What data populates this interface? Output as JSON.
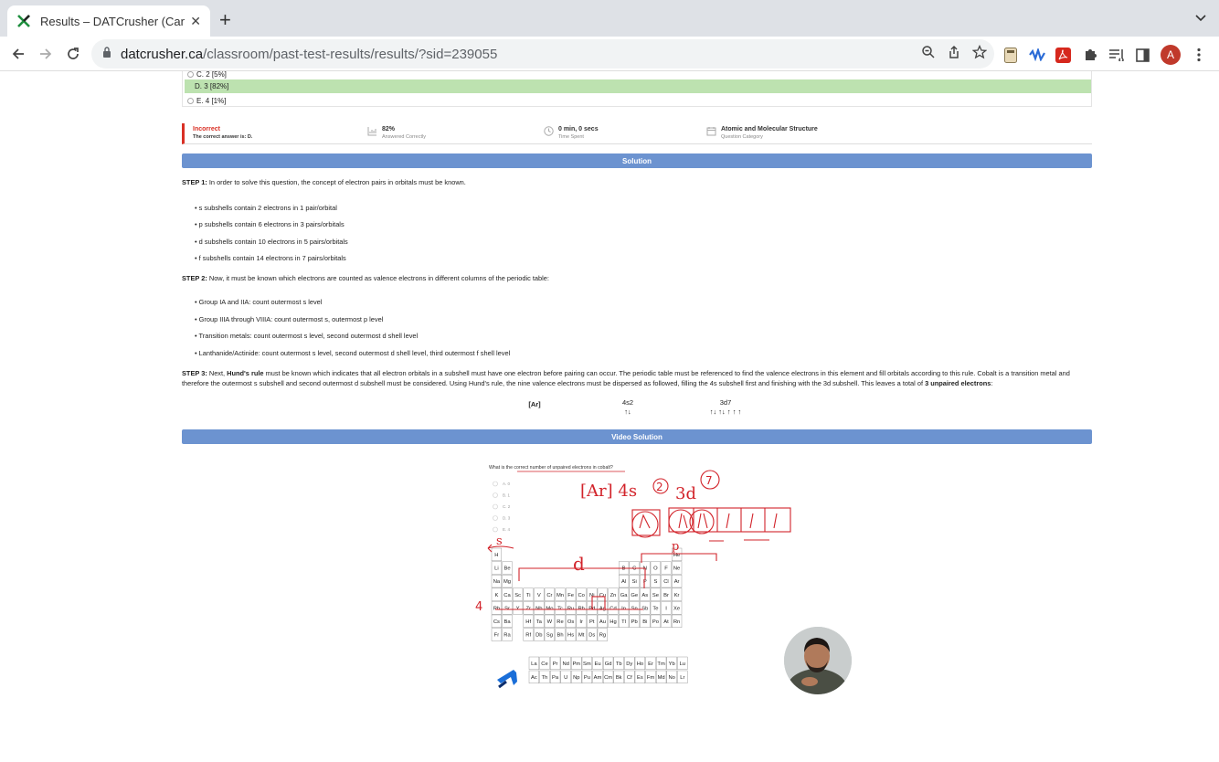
{
  "browser": {
    "tab_title": "Results – DATCrusher (Canadian",
    "url_domain": "datcrusher.ca",
    "url_path": "/classroom/past-test-results/results/?sid=239055",
    "profile_initial": "A"
  },
  "choices": [
    {
      "label": "C. 2 [5%]",
      "selected": false
    },
    {
      "label": "D. 3 [82%]",
      "selected": true
    },
    {
      "label": "E. 4 [1%]",
      "selected": false
    }
  ],
  "stats": {
    "result": "Incorrect",
    "correct_answer": "The correct answer is: D.",
    "percent": "82%",
    "percent_label": "Answered Correctly",
    "time": "0 min, 0 secs",
    "time_label": "Time Spent",
    "category": "Atomic and Molecular Structure",
    "category_label": "Question Category"
  },
  "solution": {
    "header": "Solution",
    "step1_label": "STEP 1:",
    "step1_text": " In order to solve this question, the concept of electron pairs in orbitals must be known.",
    "step1_bullets": [
      "s subshells contain 2 electrons in 1 pair/orbital",
      "p subshells contain 6 electrons in 3 pairs/orbitals",
      "d subshells contain 10 electrons in 5 pairs/orbitals",
      "f subshells contain 14 electrons in 7 pairs/orbitals"
    ],
    "step2_label": "STEP 2:",
    "step2_text": " Now, it must be known which electrons are counted as valence electrons in different columns of the periodic table:",
    "step2_bullets": [
      "Group IA and IIA: count outermost s level",
      "Group IIIA through VIIIA: count outermost s, outermost p level",
      "Transition metals: count outermost s level, second outermost d shell level",
      "Lanthanide/Actinide: count outermost s level, second outermost d shell level, third outermost f shell level"
    ],
    "step3_label": "STEP 3:",
    "step3_a": " Next, ",
    "step3_bold": "Hund's rule",
    "step3_b": " must be known which indicates that all electron orbitals in a subshell must have one electron before pairing can occur. The periodic table must be referenced to find the valence electrons in this element and fill orbitals according to this rule. Cobalt is a transition metal and therefore the outermost s subshell and second outermost d subshell must be considered. Using Hund's rule, the nine valence electrons must be dispersed as followed, filling the 4s subshell first and finishing with the 3d subshell. This leaves a total of ",
    "step3_answer": "3 unpaired electrons",
    "step3_end": ":",
    "config": {
      "core": "[Ar]",
      "s_label": "4s2",
      "s_arrows": "↑↓",
      "d_label": "3d7",
      "d_arrows": "↑↓ ↑↓ ↑ ↑ ↑"
    }
  },
  "video": {
    "header": "Video Solution",
    "question": "What is the correct number of unpaired electrons in cobalt?",
    "options": [
      "A. 0",
      "B. 1",
      "C. 2",
      "D. 3",
      "E. 4"
    ],
    "handwriting": {
      "config": "[Ar] 4s",
      "s_sup": "2",
      "d": "3d",
      "d_sup": "7",
      "s_mark": "s",
      "d_mark": "d",
      "p_mark": "p",
      "period": "4"
    },
    "pt_rows": [
      [
        "H",
        "",
        "",
        "",
        "",
        "",
        "",
        "",
        "",
        "",
        "",
        "",
        "",
        "",
        "",
        "",
        "",
        "He"
      ],
      [
        "Li",
        "Be",
        "",
        "",
        "",
        "",
        "",
        "",
        "",
        "",
        "",
        "",
        "B",
        "C",
        "N",
        "O",
        "F",
        "Ne"
      ],
      [
        "Na",
        "Mg",
        "",
        "",
        "",
        "",
        "",
        "",
        "",
        "",
        "",
        "",
        "Al",
        "Si",
        "P",
        "S",
        "Cl",
        "Ar"
      ],
      [
        "K",
        "Ca",
        "Sc",
        "Ti",
        "V",
        "Cr",
        "Mn",
        "Fe",
        "Co",
        "Ni",
        "Cu",
        "Zn",
        "Ga",
        "Ge",
        "As",
        "Se",
        "Br",
        "Kr"
      ],
      [
        "Rb",
        "Sr",
        "Y",
        "Zr",
        "Nb",
        "Mo",
        "Tc",
        "Ru",
        "Rh",
        "Pd",
        "Ag",
        "Cd",
        "In",
        "Sn",
        "Sb",
        "Te",
        "I",
        "Xe"
      ],
      [
        "Cs",
        "Ba",
        "",
        "Hf",
        "Ta",
        "W",
        "Re",
        "Os",
        "Ir",
        "Pt",
        "Au",
        "Hg",
        "Tl",
        "Pb",
        "Bi",
        "Po",
        "At",
        "Rn"
      ],
      [
        "Fr",
        "Ra",
        "",
        "Rf",
        "Db",
        "Sg",
        "Bh",
        "Hs",
        "Mt",
        "Ds",
        "Rg",
        "",
        "",
        "",
        "",
        "",
        "",
        ""
      ]
    ],
    "lanthanides": [
      "La",
      "Ce",
      "Pr",
      "Nd",
      "Pm",
      "Sm",
      "Eu",
      "Gd",
      "Tb",
      "Dy",
      "Ho",
      "Er",
      "Tm",
      "Yb",
      "Lu"
    ],
    "actinides": [
      "Ac",
      "Th",
      "Pa",
      "U",
      "Np",
      "Pu",
      "Am",
      "Cm",
      "Bk",
      "Cf",
      "Es",
      "Fm",
      "Md",
      "No",
      "Lr"
    ]
  },
  "colors": {
    "accent_bar": "#6c93d0",
    "selected_choice": "#bde2b0",
    "incorrect": "#d93025",
    "ink": "#d2232a"
  }
}
